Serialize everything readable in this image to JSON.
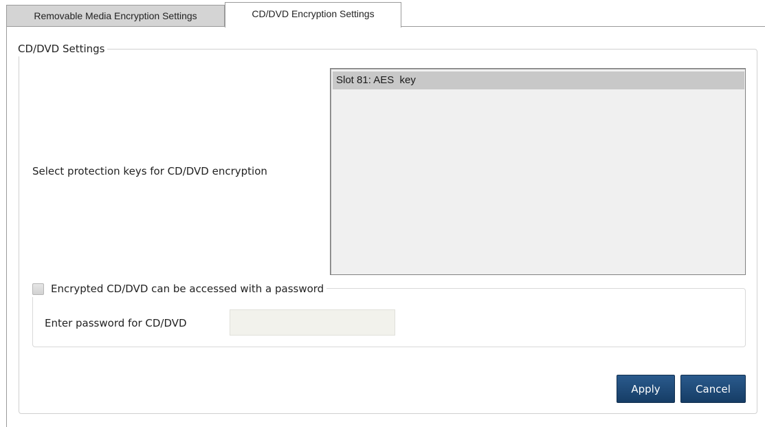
{
  "tabs": [
    {
      "label": "Removable Media Encryption Settings",
      "active": false
    },
    {
      "label": "CD/DVD Encryption Settings",
      "active": true
    }
  ],
  "cd_settings": {
    "group_title": "CD/DVD Settings",
    "keys_label": "Select protection keys for CD/DVD encryption",
    "keys": [
      {
        "label": "Slot 81: AES  key",
        "selected": true
      }
    ]
  },
  "password": {
    "checkbox_label": "Encrypted CD/DVD can be accessed with a password",
    "checked": false,
    "field_label": "Enter password for CD/DVD",
    "value": ""
  },
  "buttons": {
    "apply": "Apply",
    "cancel": "Cancel"
  },
  "colors": {
    "button_bg": "#1f4b78",
    "selected_item_bg": "#c8c8c8",
    "inactive_tab_bg": "#d4d4d4"
  }
}
